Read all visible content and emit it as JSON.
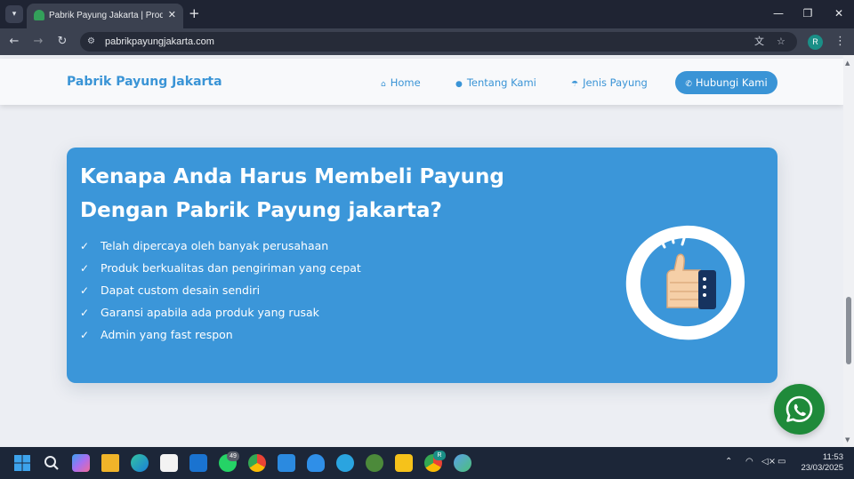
{
  "browser": {
    "tab_title": "Pabrik Payung Jakarta | Produsen",
    "tab_close": "✕",
    "new_tab": "+",
    "url": "pabrikpayungjakarta.com",
    "profile_initial": "R",
    "icons": [
      "tab-search-icon",
      "umbrella-favicon-icon",
      "close-icon",
      "plus-icon",
      "minimize-icon",
      "restore-icon",
      "close-window-icon",
      "back-icon",
      "forward-icon",
      "reload-icon",
      "site-info-icon",
      "translate-icon",
      "bookmark-star-icon",
      "menu-kebab-icon"
    ]
  },
  "site": {
    "brand": "Pabrik Payung Jakarta",
    "nav": {
      "home": "Home",
      "about": "Tentang Kami",
      "types": "Jenis Payung",
      "contact": "Hubungi Kami"
    },
    "hero": {
      "title": "Kenapa Anda Harus Membeli Payung Dengan Pabrik Payung jakarta?",
      "items": [
        "Telah dipercaya oleh banyak perusahaan",
        "Produk berkualitas dan pengiriman yang cepat",
        "Dapat custom desain sendiri",
        "Garansi apabila ada produk yang rusak",
        "Admin yang fast respon"
      ]
    },
    "colors": {
      "accent": "#3a94d6",
      "card": "#3b96d9",
      "whatsapp": "#1f8a3a"
    }
  },
  "taskbar": {
    "whatsapp_badge": "49",
    "chrome_badge": "R",
    "time": "11:53",
    "date": "23/03/2025"
  }
}
